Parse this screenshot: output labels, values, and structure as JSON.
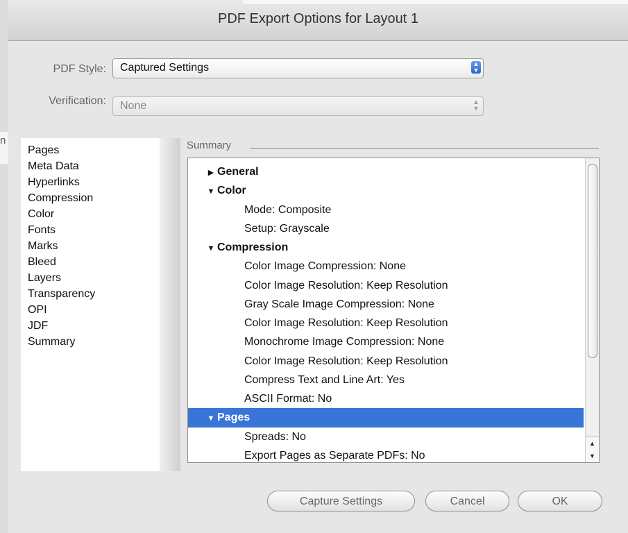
{
  "window": {
    "title": "PDF Export Options for Layout 1"
  },
  "pdf_style": {
    "label": "PDF Style:",
    "value": "Captured Settings"
  },
  "verification": {
    "label": "Verification:",
    "value": "None"
  },
  "categories": [
    "Pages",
    "Meta Data",
    "Hyperlinks",
    "Compression",
    "Color",
    "Fonts",
    "Marks",
    "Bleed",
    "Layers",
    "Transparency",
    "OPI",
    "JDF",
    "Summary"
  ],
  "summary": {
    "label": "Summary",
    "rows": [
      {
        "text": "General",
        "kind": "section",
        "expanded": false
      },
      {
        "text": "Color",
        "kind": "section",
        "expanded": true
      },
      {
        "text": "Mode: Composite",
        "kind": "item"
      },
      {
        "text": "Setup: Grayscale",
        "kind": "item"
      },
      {
        "text": "Compression",
        "kind": "section",
        "expanded": true
      },
      {
        "text": "Color Image Compression: None",
        "kind": "item"
      },
      {
        "text": "Color Image Resolution: Keep Resolution",
        "kind": "item"
      },
      {
        "text": "Gray Scale Image Compression: None",
        "kind": "item"
      },
      {
        "text": "Color Image Resolution: Keep Resolution",
        "kind": "item"
      },
      {
        "text": "Monochrome Image Compression: None",
        "kind": "item"
      },
      {
        "text": "Color Image Resolution: Keep Resolution",
        "kind": "item"
      },
      {
        "text": "Compress Text and Line Art: Yes",
        "kind": "item"
      },
      {
        "text": "ASCII Format: No",
        "kind": "item"
      },
      {
        "text": "Pages",
        "kind": "section",
        "expanded": true,
        "selected": true
      },
      {
        "text": "Spreads: No",
        "kind": "item"
      },
      {
        "text": "Export Pages as Separate PDFs: No",
        "kind": "item"
      }
    ]
  },
  "buttons": {
    "capture": "Capture Settings",
    "cancel": "Cancel",
    "ok": "OK"
  },
  "colors": {
    "selection": "#3875d7",
    "stepper": "#2a63c9"
  },
  "icons": {
    "collapsed": "disclosure-right-icon",
    "expanded": "disclosure-down-icon"
  }
}
